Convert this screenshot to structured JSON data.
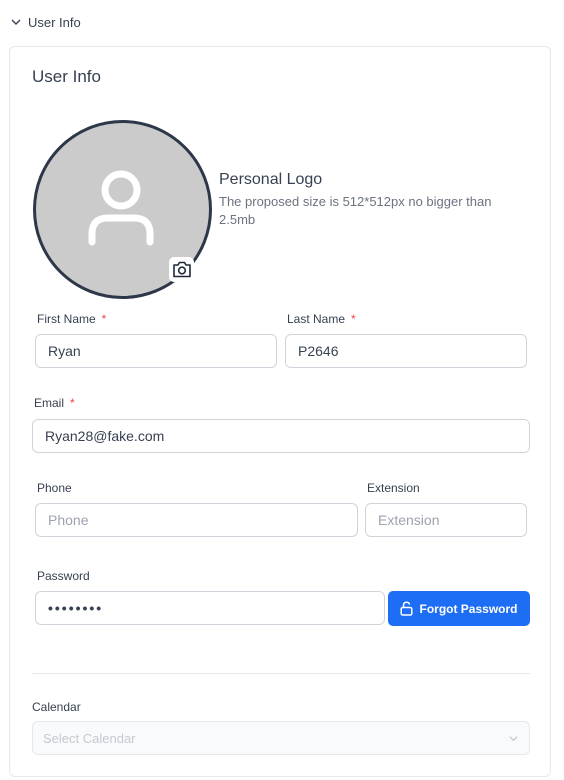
{
  "section": {
    "header_label": "User Info"
  },
  "card": {
    "title": "User Info"
  },
  "logo": {
    "title": "Personal Logo",
    "description": "The proposed size is 512*512px no bigger than 2.5mb",
    "icons": {
      "avatar": "user-icon",
      "upload": "camera-icon"
    }
  },
  "form": {
    "first_name": {
      "label": "First Name",
      "required_mark": "*",
      "value": "Ryan"
    },
    "last_name": {
      "label": "Last Name",
      "required_mark": "*",
      "value": "P2646"
    },
    "email": {
      "label": "Email",
      "required_mark": "*",
      "value": "Ryan28@fake.com"
    },
    "phone": {
      "label": "Phone",
      "placeholder": "Phone"
    },
    "extension": {
      "label": "Extension",
      "placeholder": "Extension"
    },
    "password": {
      "label": "Password",
      "value": "••••••••"
    },
    "forgot_password": {
      "label": "Forgot Password",
      "icon": "unlock-icon"
    },
    "calendar": {
      "label": "Calendar",
      "placeholder": "Select Calendar",
      "icon": "chevron-down-icon"
    }
  },
  "colors": {
    "primary": "#1d6ef5",
    "required": "#ef4444",
    "avatar_bg": "#cbcbcb",
    "avatar_border": "#2d3748"
  }
}
